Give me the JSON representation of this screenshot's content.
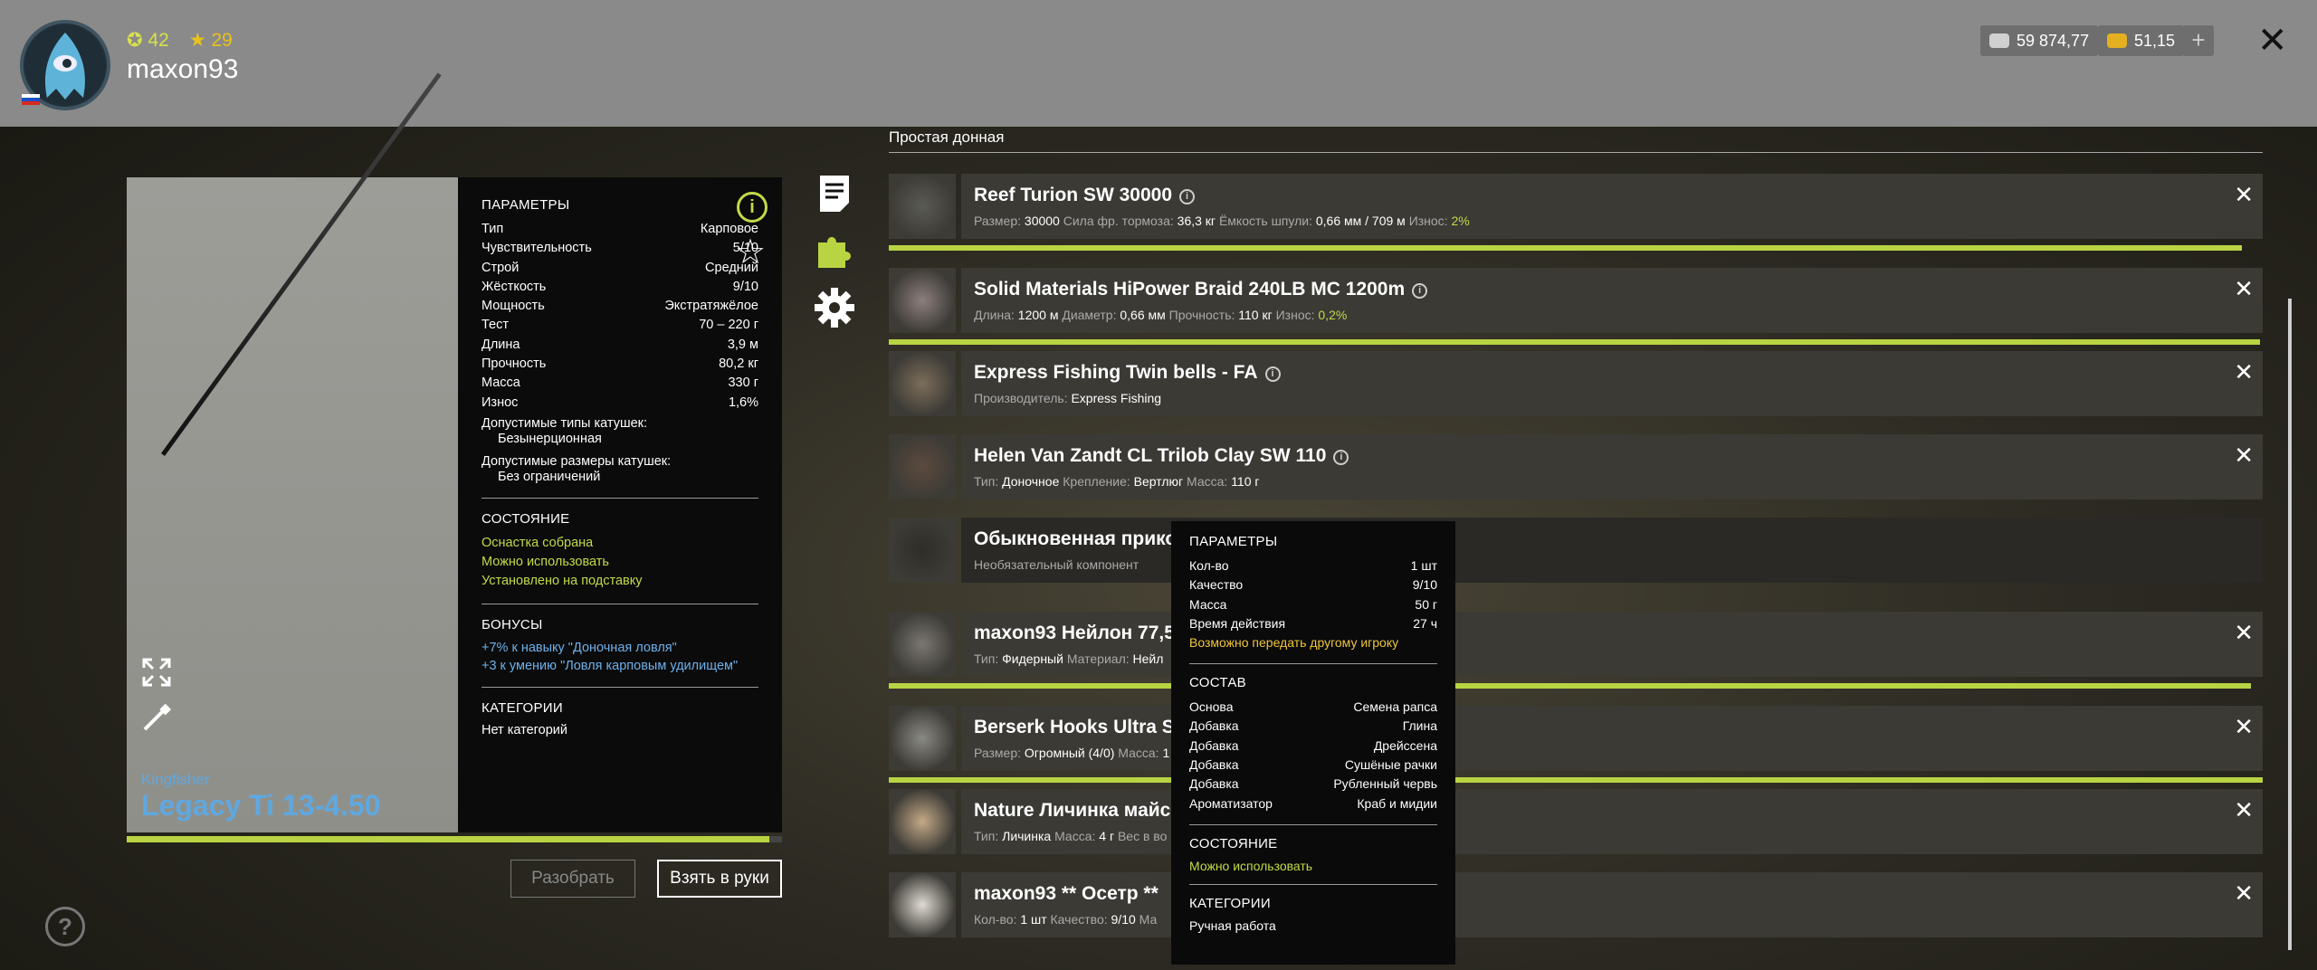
{
  "player": {
    "level": "42",
    "rank": "29",
    "username": "maxon93",
    "currency_silver": "59 874,77",
    "currency_gold": "51,15"
  },
  "rod": {
    "brand": "Kingfisher",
    "name": "Legacy Ti 13-4.50",
    "wear_fraction": 0.984,
    "params_title": "ПАРАМЕТРЫ",
    "params": [
      {
        "k": "Тип",
        "v": "Карповое"
      },
      {
        "k": "Чувствительность",
        "v": "5/10"
      },
      {
        "k": "Строй",
        "v": "Средний"
      },
      {
        "k": "Жёсткость",
        "v": "9/10"
      },
      {
        "k": "Мощность",
        "v": "Экстратяжёлое"
      },
      {
        "k": "Тест",
        "v": "70 – 220 г"
      },
      {
        "k": "Длина",
        "v": "3,9 м"
      },
      {
        "k": "Прочность",
        "v": "80,2 кг"
      },
      {
        "k": "Масса",
        "v": "330 г"
      },
      {
        "k": "Износ",
        "v": "1,6%"
      }
    ],
    "reel_types_label": "Допустимые типы катушек:",
    "reel_types_value": "Безынерционная",
    "reel_sizes_label": "Допустимые размеры катушек:",
    "reel_sizes_value": "Без ограничений",
    "state_title": "СОСТОЯНИЕ",
    "state": [
      "Оснастка собрана",
      "Можно использовать",
      "Установлено на подставку"
    ],
    "bonuses_title": "БОНУСЫ",
    "bonus_1": "+7% к навыку \"Доночная ловля\"",
    "bonus_2": "+3 к умению \"Ловля карповым удилищем\"",
    "categories_title": "КАТЕГОРИИ",
    "categories_value": "Нет категорий"
  },
  "buttons": {
    "disassemble": "Разобрать",
    "take": "Взять в руки"
  },
  "tackle": {
    "title": "Простая донная",
    "items": [
      {
        "name": "Reef Turion SW 30000",
        "specs": [
          [
            "Размер:",
            "30000"
          ],
          [
            "Сила фр. тормоза:",
            "36,3 кг"
          ],
          [
            "Ёмкость шпули:",
            "0,66 мм / 709 м"
          ],
          [
            "Износ:",
            "2%"
          ]
        ]
      },
      {
        "name": "Solid Materials HiPower Braid 240LB MC 1200m",
        "specs": [
          [
            "Длина:",
            "1200 м"
          ],
          [
            "Диаметр:",
            "0,66 мм"
          ],
          [
            "Прочность:",
            "110 кг"
          ],
          [
            "Износ:",
            "0,2%"
          ]
        ]
      },
      {
        "name": "Express Fishing Twin bells - FA",
        "specs": [
          [
            "Производитель:",
            "Express Fishing"
          ]
        ]
      },
      {
        "name": "Helen Van Zandt CL Trilob Clay SW 110",
        "specs": [
          [
            "Тип:",
            "Доночное"
          ],
          [
            "Крепление:",
            "Вертлюг"
          ],
          [
            "Масса:",
            "110 г"
          ]
        ]
      },
      {
        "name": "Обыкновенная прико",
        "specs": [
          [
            "Необязательный компонент",
            ""
          ]
        ]
      },
      {
        "name": "maxon93 Нейлон 77,5",
        "specs": [
          [
            "Тип:",
            "Фидерный"
          ],
          [
            "Материал:",
            "Нейл"
          ]
        ]
      },
      {
        "name": "Berserk Hooks Ultra Se",
        "specs": [
          [
            "Размер:",
            "Огромный (4/0)"
          ],
          [
            "Масса:",
            "1"
          ]
        ]
      },
      {
        "name": "Nature Личинка майск",
        "specs": [
          [
            "Тип:",
            "Личинка"
          ],
          [
            "Масса:",
            "4 г"
          ],
          [
            "Вес в во",
            ""
          ]
        ]
      },
      {
        "name": "maxon93 ** Осетр **",
        "specs": [
          [
            "Кол-во:",
            "1 шт"
          ],
          [
            "Качество:",
            "9/10"
          ],
          [
            "Ма",
            ""
          ]
        ]
      }
    ]
  },
  "tooltip": {
    "params_title": "ПАРАМЕТРЫ",
    "params": [
      {
        "k": "Кол-во",
        "v": "1 шт"
      },
      {
        "k": "Качество",
        "v": "9/10"
      },
      {
        "k": "Масса",
        "v": "50 г"
      },
      {
        "k": "Время действия",
        "v": "27 ч"
      }
    ],
    "transfer_note": "Возможно передать другому игроку",
    "composition_title": "СОСТАВ",
    "composition": [
      {
        "k": "Основа",
        "v": "Семена рапса"
      },
      {
        "k": "Добавка",
        "v": "Глина"
      },
      {
        "k": "Добавка",
        "v": "Дрейссена"
      },
      {
        "k": "Добавка",
        "v": "Сушёные рачки"
      },
      {
        "k": "Добавка",
        "v": "Рубленный червь"
      },
      {
        "k": "Ароматизатор",
        "v": "Краб и мидии"
      }
    ],
    "state_title": "СОСТОЯНИЕ",
    "state_value": "Можно использовать",
    "categories_title": "КАТЕГОРИИ",
    "categories_value": "Ручная работа"
  },
  "colors": {
    "accent_green": "#c3da48",
    "link_blue": "#6db0ea",
    "highlight_yellow": "#f0c53a"
  }
}
